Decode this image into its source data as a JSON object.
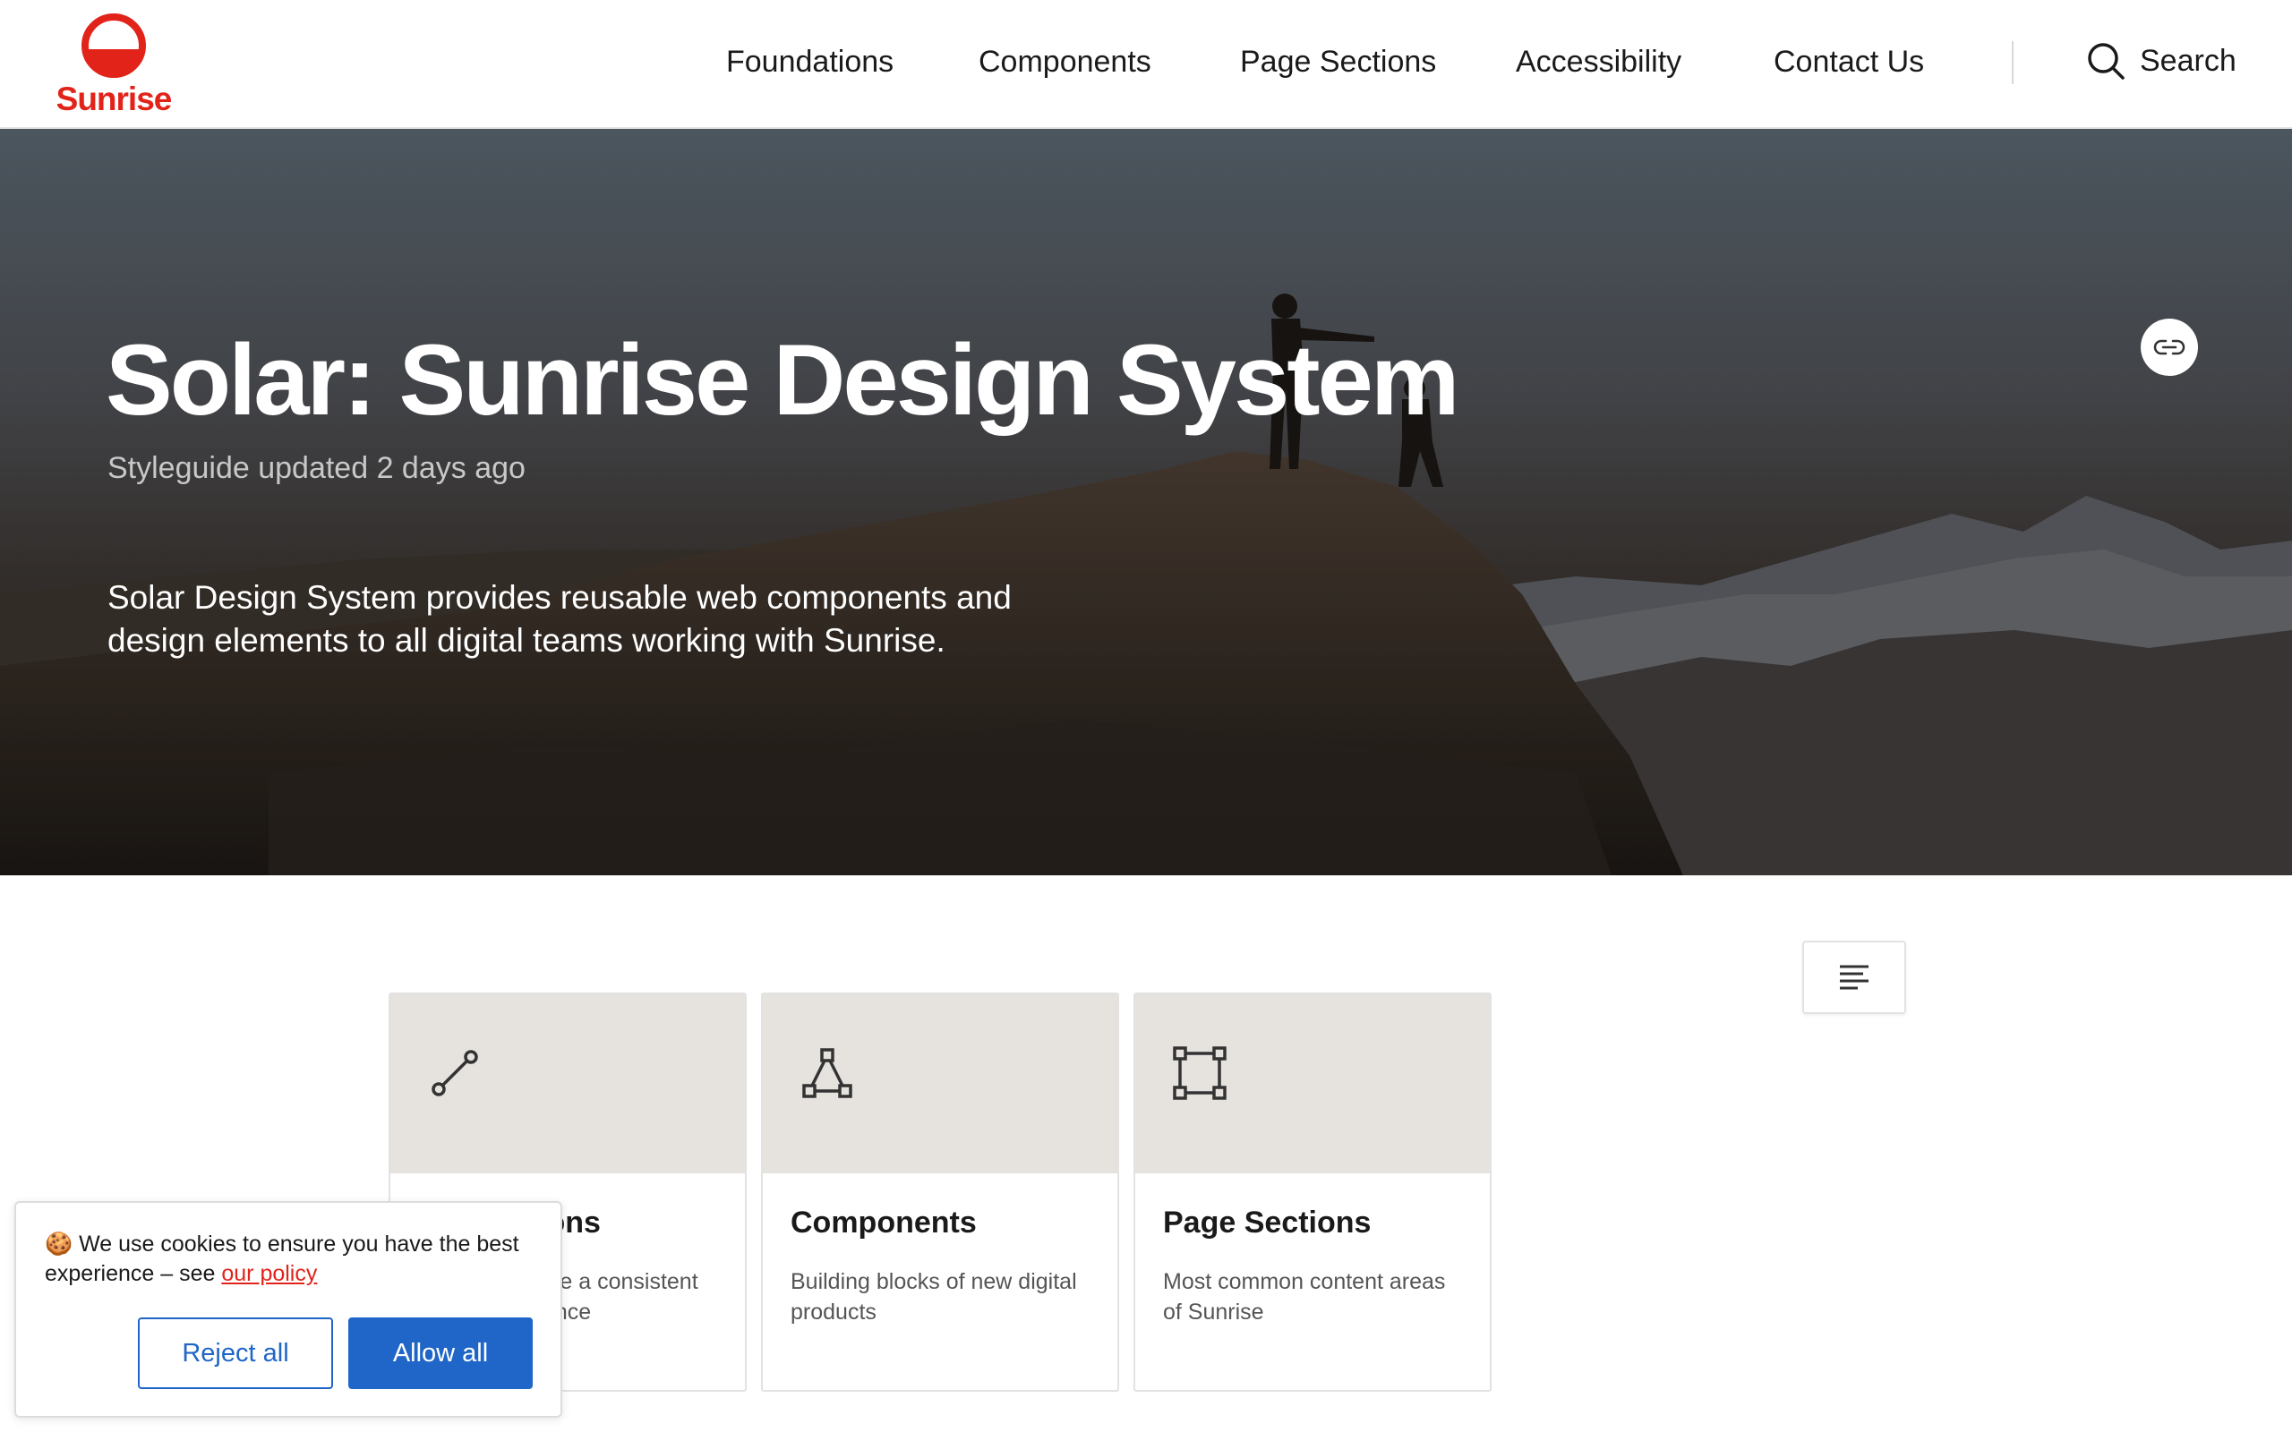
{
  "header": {
    "logo_text": "Sunrise",
    "nav": [
      {
        "label": "Foundations"
      },
      {
        "label": "Components"
      },
      {
        "label": "Page Sections"
      },
      {
        "label": "Accessibility"
      },
      {
        "label": "Contact Us"
      }
    ],
    "search_label": "Search"
  },
  "hero": {
    "title": "Solar: Sunrise Design System",
    "updated": "Styleguide updated 2 days ago",
    "description": "Solar Design System provides reusable web components and design elements to all digital teams working with Sunrise."
  },
  "cards": [
    {
      "title": "Foundations",
      "description": "Styles to create a consistent visual experience",
      "icon": "line-segment-icon"
    },
    {
      "title": "Components",
      "description": "Building blocks of new digital products",
      "icon": "triangle-nodes-icon"
    },
    {
      "title": "Page Sections",
      "description": "Most common content areas of Sunrise",
      "icon": "square-nodes-icon"
    }
  ],
  "cookie": {
    "emoji": "🍪",
    "text": "We use cookies to ensure you have the best experience – see ",
    "link": "our policy",
    "reject_label": "Reject all",
    "allow_label": "Allow all"
  },
  "colors": {
    "brand": "#e2231a",
    "primary_button": "#1f66c8",
    "card_top": "#e6e3df"
  }
}
